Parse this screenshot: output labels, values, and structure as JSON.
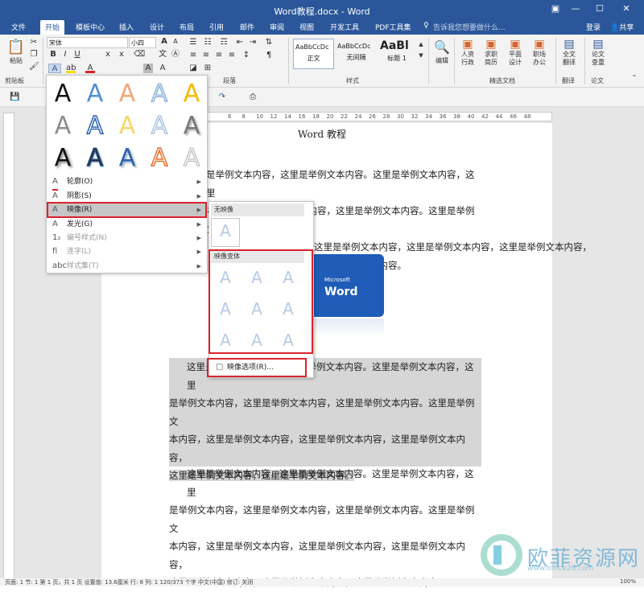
{
  "window": {
    "title": "Word教程.docx - Word"
  },
  "tabs": [
    "文件",
    "开始",
    "模板中心",
    "插入",
    "设计",
    "布局",
    "引用",
    "邮件",
    "审阅",
    "视图",
    "开发工具",
    "PDF工具集"
  ],
  "tell_me": "告诉我您想要做什么...",
  "login": "登录",
  "share": "共享",
  "ribbon": {
    "paste": "粘贴",
    "font_name": "宋体",
    "font_size": "小四",
    "groups": {
      "clipboard": "剪贴板",
      "paragraph": "段落",
      "styles": "样式",
      "feature": "精选文档",
      "translate": "翻译",
      "paper": "论文"
    },
    "styles": [
      {
        "preview": "AaBbCcDc",
        "name": "正文"
      },
      {
        "preview": "AaBbCcDc",
        "name": "无间隔"
      },
      {
        "preview": "AaBl",
        "name": "标题 1"
      }
    ],
    "edit": "编辑",
    "feature_btns": [
      {
        "l1": "人资",
        "l2": "行政"
      },
      {
        "l1": "求职",
        "l2": "简历"
      },
      {
        "l1": "平面",
        "l2": "设计"
      },
      {
        "l1": "职场",
        "l2": "办公"
      }
    ],
    "translate_btn": {
      "l1": "全文",
      "l2": "翻译"
    },
    "paper_btn": {
      "l1": "论文",
      "l2": "查重"
    }
  },
  "ruler_numbers": [
    "6",
    "8",
    "10",
    "12",
    "14",
    "16",
    "18",
    "20",
    "22",
    "24",
    "26",
    "28",
    "30",
    "32",
    "34",
    "36",
    "38",
    "40",
    "42",
    "44",
    "46",
    "48"
  ],
  "document": {
    "title": "Word 教程",
    "image": {
      "line1": "Microsoft",
      "line2": "Word"
    },
    "para1": [
      "是举例文本内容，这里是举例文本内容。这里是举例文本内容，这里",
      "本内容，这里是举例文本内容，这里是举例文本内容。这里是举例文",
      "这里是举例文本内容，这里是举例文本内容，这里是举例文本内容，",
      "这里是举例文本内容。"
    ],
    "para2": [
      "这里是举例文本内容，这里是举例文本内容。这里是举例文本内容，这里",
      "是举例文本内容，这里是举例文本内容，这里是举例文本内容。这里是举例文",
      "本内容，这里是举例文本内容，这里是举例文本内容，这里是举例文本内容，",
      "这里是举例文本内容，这里是举例文本内容。"
    ],
    "para3": [
      "这里是举例文本内容，这里是举例文本内容。这里是举例文本内容，这里",
      "是举例文本内容，这里是举例文本内容，这里是举例文本内容。这里是举例文",
      "本内容，这里是举例文本内容，这里是举例文本内容，这里是举例文本内容，",
      "这里是举例文本内容，这里是举例文本内容，这里是举例文本内容。"
    ]
  },
  "text_effects_menu": {
    "items": [
      {
        "label": "轮廓(O)",
        "icon": "outline-icon"
      },
      {
        "label": "阴影(S)",
        "icon": "shadow-icon"
      },
      {
        "label": "映像(R)",
        "icon": "reflection-icon"
      },
      {
        "label": "发光(G)",
        "icon": "glow-icon"
      },
      {
        "label": "编号样式(N)",
        "icon": "number-style-icon"
      },
      {
        "label": "连字(L)",
        "icon": "ligature-icon"
      },
      {
        "label": "样式集(T)",
        "icon": "stylistic-set-icon"
      }
    ]
  },
  "reflection_menu": {
    "no_reflection": "无映像",
    "variants": "映像变体",
    "options": "映像选项(R)..."
  },
  "statusbar": {
    "text": "页面: 1    节: 1    第 1 页，共 1 页    设置值: 13.6厘米    行: 8    列: 1    120/373 个字    中文(中国)    修订: 关闭",
    "zoom": "100%"
  },
  "watermark": {
    "cn": "欧菲资源网",
    "url": "www.office26.com"
  }
}
